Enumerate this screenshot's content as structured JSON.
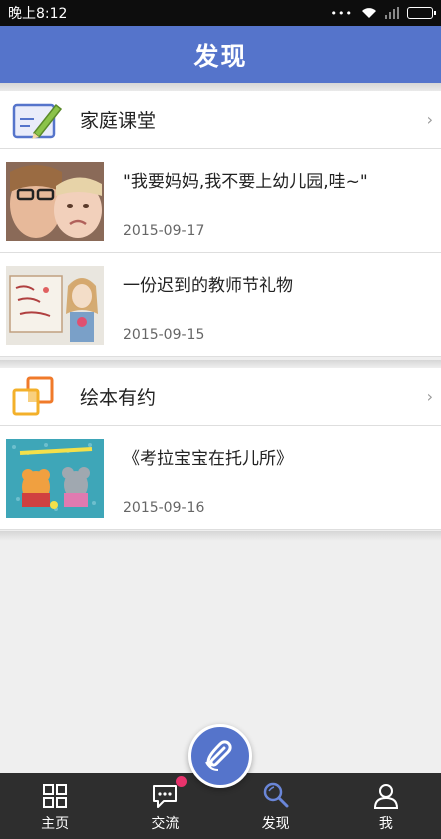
{
  "status_bar": {
    "time": "晚上8:12"
  },
  "header": {
    "title": "发现"
  },
  "sections": [
    {
      "title": "家庭课堂",
      "items": [
        {
          "title": "\"我要妈妈,我不要上幼儿园,哇~\"",
          "date": "2015-09-17"
        },
        {
          "title": "一份迟到的教师节礼物",
          "date": "2015-09-15"
        }
      ]
    },
    {
      "title": "绘本有约",
      "items": [
        {
          "title": "《考拉宝宝在托儿所》",
          "date": "2015-09-16"
        }
      ]
    }
  ],
  "tabbar": {
    "tabs": [
      {
        "label": "主页",
        "icon": "grid-icon"
      },
      {
        "label": "交流",
        "icon": "chat-icon"
      },
      {
        "label": "发现",
        "icon": "search-icon"
      },
      {
        "label": "我",
        "icon": "person-icon"
      }
    ],
    "active": "发现"
  },
  "colors": {
    "brand": "#5574cb",
    "badge": "#e8336c",
    "tabbar": "#2e2e2e"
  }
}
